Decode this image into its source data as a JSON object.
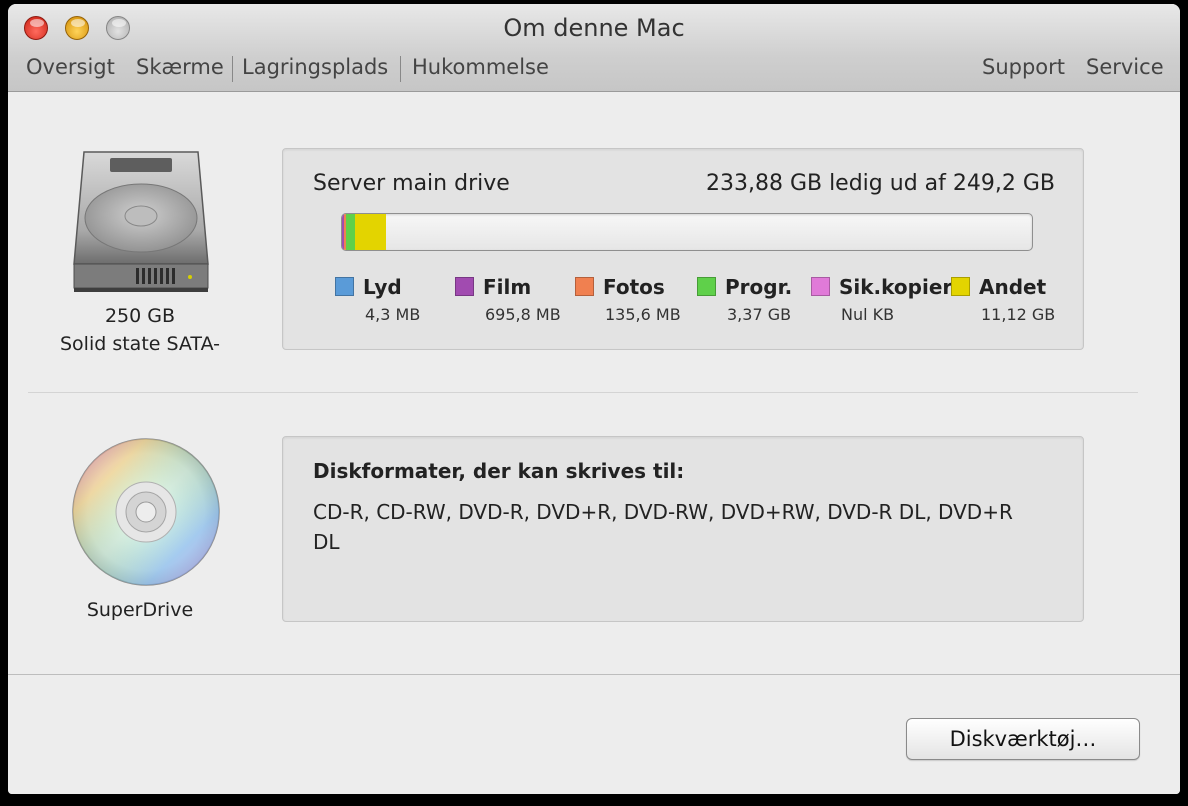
{
  "window": {
    "title": "Om denne Mac"
  },
  "tabs": {
    "left": [
      "Oversigt",
      "Skærme",
      "Lagringsplads",
      "Hukommelse"
    ],
    "right": [
      "Support",
      "Service"
    ],
    "active": "Lagringsplads"
  },
  "hard_drive": {
    "icon": "hard-drive-icon",
    "size_label": "250 GB",
    "type_label": "Solid state SATA-",
    "name": "Server main drive",
    "free_text": "233,88 GB ledig ud af 249,2 GB",
    "capacity_gb": 249.2,
    "free_gb": 233.88,
    "legend": [
      {
        "label": "Lyd",
        "value": "4,3 MB",
        "color": "#5a9bd8",
        "fraction": 0.0
      },
      {
        "label": "Film",
        "value": "695,8 MB",
        "color": "#a14bb0",
        "fraction": 0.0028
      },
      {
        "label": "Fotos",
        "value": "135,6 MB",
        "color": "#f08050",
        "fraction": 0.0005
      },
      {
        "label": "Progr.",
        "value": "3,37 GB",
        "color": "#5fd04a",
        "fraction": 0.0135
      },
      {
        "label": "Sik.kopier",
        "value": "Nul KB",
        "color": "#e07ad8",
        "fraction": 0.0
      },
      {
        "label": "Andet",
        "value": "11,12 GB",
        "color": "#e3d400",
        "fraction": 0.0446
      }
    ]
  },
  "optical_drive": {
    "icon": "cd-icon",
    "label": "SuperDrive",
    "formats_title": "Diskformater, der kan skrives til:",
    "formats_text": "CD-R, CD-RW, DVD-R, DVD+R, DVD-RW, DVD+RW, DVD-R DL, DVD+R DL"
  },
  "footer": {
    "disk_utility_label": "Diskværktøj…"
  }
}
